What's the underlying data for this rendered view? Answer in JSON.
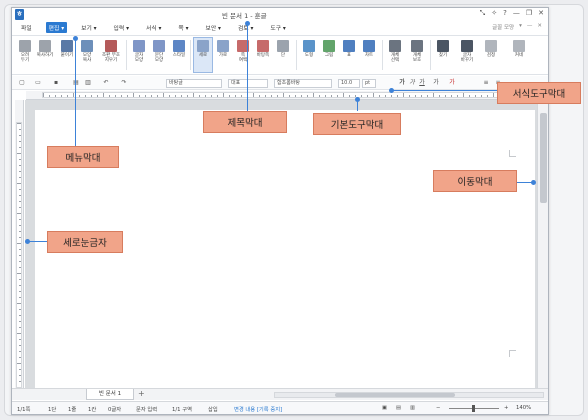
{
  "window": {
    "app_icon": "ㅎ",
    "title": "빈 문서 1 - 훈글",
    "controls": [
      "⤡",
      "✧",
      "?",
      "—",
      "❐",
      "✕"
    ]
  },
  "menubar": {
    "items": [
      "파일",
      "편집",
      "보기",
      "입력",
      "서식",
      "쪽",
      "보안",
      "검토",
      "도구"
    ],
    "dropdown_marker": "▾",
    "right": [
      "글꼴 모양",
      "▾",
      "—",
      "✕"
    ]
  },
  "ribbon": {
    "buttons": [
      {
        "label": "오려\n두기",
        "color": "#9da3ab"
      },
      {
        "label": "복사하기",
        "color": "#9da3ab"
      },
      {
        "label": "붙이기",
        "color": "#5a79a6"
      },
      {
        "label": "모양\n복사",
        "color": "#6d8fba"
      },
      {
        "label": "조판 부호\n지우기",
        "color": "#b45a5a"
      },
      {
        "label": "글자\n모양",
        "color": "#7f96c7"
      },
      {
        "label": "문단\n모양",
        "color": "#7f96c7"
      },
      {
        "label": "스타일",
        "color": "#5d86c5"
      },
      {
        "label": "세로",
        "color": "#8aa3c9"
      },
      {
        "label": "가로",
        "color": "#8aa3c9"
      },
      {
        "label": "쪽\n여백",
        "color": "#c66a6a"
      },
      {
        "label": "바탕쪽",
        "color": "#c66a6a"
      },
      {
        "label": "단",
        "color": "#9ba3ad"
      },
      {
        "label": "도형",
        "color": "#5a93c9"
      },
      {
        "label": "그림",
        "color": "#62a46b"
      },
      {
        "label": "표",
        "color": "#4f7fc0"
      },
      {
        "label": "차트",
        "color": "#4f7fc0"
      },
      {
        "label": "개체\n선택",
        "color": "#6b7480"
      },
      {
        "label": "개체\n보호",
        "color": "#6b7480"
      },
      {
        "label": "찾기",
        "color": "#4b5563"
      },
      {
        "label": "글자\n바꾸기",
        "color": "#4b5563"
      },
      {
        "label": "검정",
        "color": "#b0b5bc"
      },
      {
        "label": "커네",
        "color": "#b0b5bc"
      }
    ]
  },
  "format_bar": {
    "style": "바탕글",
    "lang": "대표",
    "font": "함초롬바탕",
    "size": "10.0",
    "unit": "pt",
    "char_buttons": [
      "가",
      "가",
      "가",
      "가",
      "가"
    ]
  },
  "tabs": {
    "doc_tab": "빈 문서 1",
    "add": "+"
  },
  "statusbar": {
    "page": "1/1쪽",
    "section": "1단",
    "line": "1줄",
    "column": "1칸",
    "chars": "0글자",
    "mode": "문자 입력",
    "sections": "1/1 구역",
    "insert": "삽입",
    "track": "변경 내용 [기록 중지]",
    "zoom": "140%"
  },
  "callouts": {
    "menubar": "메뉴막대",
    "titlebar": "제목막대",
    "toolbar": "기본도구막대",
    "formatbar": "서식도구막대",
    "scrollbar": "이동막대",
    "ruler": "세로눈금자"
  }
}
